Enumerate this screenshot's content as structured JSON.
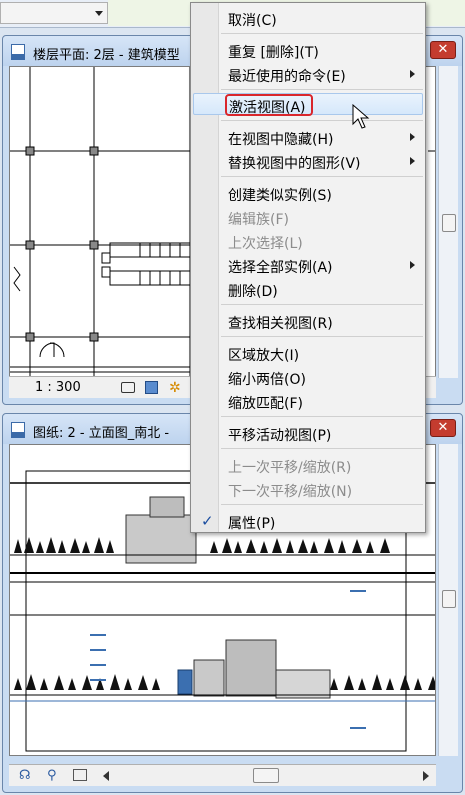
{
  "top_window": {
    "title": "楼层平面: 2层 - 建筑模型",
    "close_label": "✕",
    "scale_label": "1 : 300"
  },
  "bottom_window": {
    "title": "图纸: 2 - 立面图_南北 -",
    "close_label": "✕"
  },
  "context_menu": {
    "items": [
      {
        "label": "取消(C)",
        "enabled": true,
        "submenu": false
      },
      {
        "label": "重复 [删除](T)",
        "enabled": true,
        "submenu": false
      },
      {
        "label": "最近使用的命令(E)",
        "enabled": true,
        "submenu": true
      },
      {
        "label": "激活视图(A)",
        "enabled": true,
        "submenu": false,
        "highlighted": true
      },
      {
        "label": "在视图中隐藏(H)",
        "enabled": true,
        "submenu": true
      },
      {
        "label": "替换视图中的图形(V)",
        "enabled": true,
        "submenu": true
      },
      {
        "label": "创建类似实例(S)",
        "enabled": true,
        "submenu": false
      },
      {
        "label": "编辑族(F)",
        "enabled": false,
        "submenu": false
      },
      {
        "label": "上次选择(L)",
        "enabled": false,
        "submenu": false
      },
      {
        "label": "选择全部实例(A)",
        "enabled": true,
        "submenu": true
      },
      {
        "label": "删除(D)",
        "enabled": true,
        "submenu": false
      },
      {
        "label": "查找相关视图(R)",
        "enabled": true,
        "submenu": false
      },
      {
        "label": "区域放大(I)",
        "enabled": true,
        "submenu": false
      },
      {
        "label": "缩小两倍(O)",
        "enabled": true,
        "submenu": false
      },
      {
        "label": "缩放匹配(F)",
        "enabled": true,
        "submenu": false
      },
      {
        "label": "平移活动视图(P)",
        "enabled": true,
        "submenu": false
      },
      {
        "label": "上一次平移/缩放(R)",
        "enabled": false,
        "submenu": false
      },
      {
        "label": "下一次平移/缩放(N)",
        "enabled": false,
        "submenu": false
      },
      {
        "label": "属性(P)",
        "enabled": true,
        "submenu": false,
        "checked": true
      }
    ],
    "check_mark": "✓"
  }
}
